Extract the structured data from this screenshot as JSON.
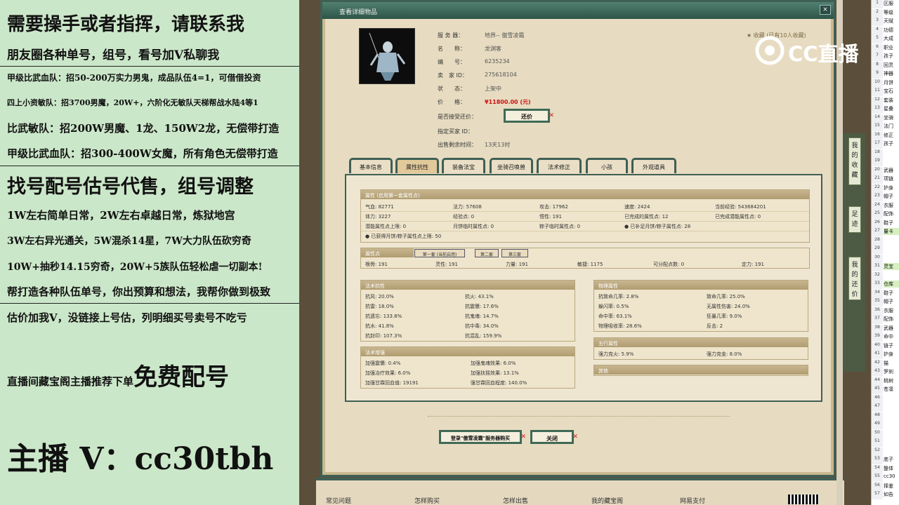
{
  "ad": {
    "lines": [
      "需要操手或者指挥，请联系我",
      "朋友圈各种单号，组号，看号加V私聊我",
      "甲级比武血队：招50-200万实力男鬼，成品队伍4=1，可借借投资",
      "四上小资敏队：招3700男魔，20W+，六阶化无敏队天梯帮战水陆4等1",
      "比武敏队：招200W男魔、1龙、150W2龙，无偿带打造",
      "甲级比武血队：招300-400W女魔，所有角色无偿带打造",
      "找号配号估号代售，组号调整",
      "1W左右简单日常，2W左右卓越日常，炼狱地宫",
      "3W左右异光通关，5W混杀14星，7W大力队伍砍穷奇",
      "10W+抽秒14.15穷奇，20W+5族队伍轻松虐一切副本!",
      "帮打造各种队伍单号，你出预算和想法，我帮你做到极致",
      "估价加我V，没链接上号估，列明细买号卖号不吃亏"
    ],
    "promo_prefix": "直播间藏宝阁主播推荐下单",
    "promo_big": "免费配号",
    "contact": "主播 V：cc30tbh"
  },
  "dialog": {
    "title": "查看详细物品",
    "fav": "收藏 (已有10人收藏)",
    "fields": [
      {
        "label": "服 务 器：",
        "value": "地界-- 傲雪凌霜"
      },
      {
        "label": "名　　称：",
        "value": "龙渊客"
      },
      {
        "label": "编　　号：",
        "value": "6235234"
      },
      {
        "label": "卖　家 ID：",
        "value": "275618104"
      },
      {
        "label": "状　　态：",
        "value": "上架中"
      },
      {
        "label": "价　　格：",
        "value": "¥11800.00 (元)"
      }
    ],
    "counter_label": "是否接受还价：",
    "counter_btn": "还价",
    "buyer_label": "指定买家 ID：",
    "remain_label": "出售剩余时间：",
    "remain_value": "13天13时",
    "tabs": [
      "基本信息",
      "属性抗性",
      "装备法宝",
      "坐骑召唤兽",
      "法术修正",
      "小孩",
      "外观道具"
    ],
    "attr": {
      "title": "属性 (启用第一套属性点)",
      "rows": [
        [
          "气血: 82771",
          "法力: 57608",
          "攻击: 17962",
          "速度: 2424",
          "当前经验: 543684201"
        ],
        [
          "体力: 3227",
          "经验点: 0",
          "悟性: 191",
          "已完成的属性点: 12",
          "已完成潜能属性点: 0"
        ],
        [
          "潜能属性点上限: 0",
          "月饼临时属性点: 0",
          "粽子临时属性点: 0",
          "已补足月饼/粽子属性点: 28",
          ""
        ],
        [
          "已获得月饼/粽子属性点上限: 50",
          "",
          "",
          "",
          ""
        ]
      ]
    },
    "points": {
      "title": "属性点",
      "subtabs": [
        "第一套 (当前启用)",
        "第二套",
        "第三套"
      ],
      "items": [
        "根骨: 191",
        "灵性: 191",
        "力量: 191",
        "敏捷: 1175",
        "可分配点数: 0",
        "定力: 191"
      ]
    },
    "resist": {
      "title": "法术抗性",
      "items": [
        "抗风: 20.0%",
        "抗火: 43.1%",
        "抗雷: 18.0%",
        "抗震慑: 17.6%",
        "抗遗忘: 133.8%",
        "抗鬼魂: 14.7%",
        "抗水: 41.8%",
        "抗中毒: 34.0%",
        "抗封印: 107.3%",
        "抗混乱: 159.9%"
      ]
    },
    "boost": {
      "title": "法术增强",
      "items": [
        "加强震慑: 0.4%",
        "加强鬼魂效果: 6.0%",
        "加强冶疗效果: 6.0%",
        "加强扶摇效果: 13.1%",
        "加强甘霖回血值: 19191",
        "强甘霖回血程度: 140.0%"
      ]
    },
    "phys": {
      "title": "物理属性",
      "items": [
        "抗致命几率: 2.8%",
        "致命几率: 25.0%",
        "躲闪率: 0.5%",
        "无属性伤害: 24.0%",
        "命中率: 63.1%",
        "狂暴几率: 9.0%",
        "物理吸收率: 28.6%",
        "反击: 2"
      ]
    },
    "wuxing": {
      "title": "五行属性",
      "items": [
        "强力克火: 5.9%",
        "强力克金: 8.0%"
      ]
    },
    "other": {
      "title": "其他"
    },
    "buy_btn": "登录\"傲雪凌霜\"服务器购买",
    "close_btn": "关闭"
  },
  "footer": [
    "常见问题",
    "怎样购买",
    "怎样出售",
    "我的藏宝阁",
    "网易支付"
  ],
  "sidetabs": [
    "我的收藏",
    "足迹",
    "我的还价"
  ],
  "logo": "CC直播",
  "sheet": [
    [
      "1",
      "区服"
    ],
    [
      "2",
      "等级"
    ],
    [
      "3",
      "天赋"
    ],
    [
      "4",
      "功德"
    ],
    [
      "5",
      "大成"
    ],
    [
      "6",
      "职业"
    ],
    [
      "7",
      "孩子"
    ],
    [
      "8",
      "回灵"
    ],
    [
      "9",
      "神器"
    ],
    [
      "10",
      "月饼"
    ],
    [
      "11",
      "宝石"
    ],
    [
      "12",
      "套装"
    ],
    [
      "13",
      "星叠"
    ],
    [
      "14",
      "坐骑"
    ],
    [
      "15",
      "法门"
    ],
    [
      "16",
      "修正"
    ],
    [
      "17",
      "孩子"
    ],
    [
      "18",
      ""
    ],
    [
      "19",
      ""
    ],
    [
      "20",
      "武器"
    ],
    [
      "21",
      "项链"
    ],
    [
      "22",
      "护身"
    ],
    [
      "23",
      "帽子"
    ],
    [
      "24",
      "衣服"
    ],
    [
      "25",
      "配饰"
    ],
    [
      "26",
      "鞋子"
    ],
    [
      "27",
      "量卡"
    ],
    [
      "28",
      ""
    ],
    [
      "29",
      ""
    ],
    [
      "30",
      ""
    ],
    [
      "31",
      "灵宝"
    ],
    [
      "32",
      ""
    ],
    [
      "33",
      "仓库"
    ],
    [
      "34",
      "鞋子"
    ],
    [
      "35",
      "帽子"
    ],
    [
      "36",
      "衣服"
    ],
    [
      "37",
      "配饰"
    ],
    [
      "38",
      "武器"
    ],
    [
      "39",
      "命中"
    ],
    [
      "40",
      "链子"
    ],
    [
      "41",
      "护身"
    ],
    [
      "42",
      "猫"
    ],
    [
      "43",
      "罗刹"
    ],
    [
      "44",
      "桃树"
    ],
    [
      "45",
      "苍凛"
    ],
    [
      "46",
      ""
    ],
    [
      "47",
      ""
    ],
    [
      "48",
      ""
    ],
    [
      "49",
      ""
    ],
    [
      "50",
      ""
    ],
    [
      "51",
      ""
    ],
    [
      "52",
      ""
    ],
    [
      "53",
      "底子"
    ],
    [
      "54",
      "整体"
    ],
    [
      "55",
      "cc30"
    ],
    [
      "56",
      "择鉴"
    ],
    [
      "57",
      "如告"
    ]
  ]
}
